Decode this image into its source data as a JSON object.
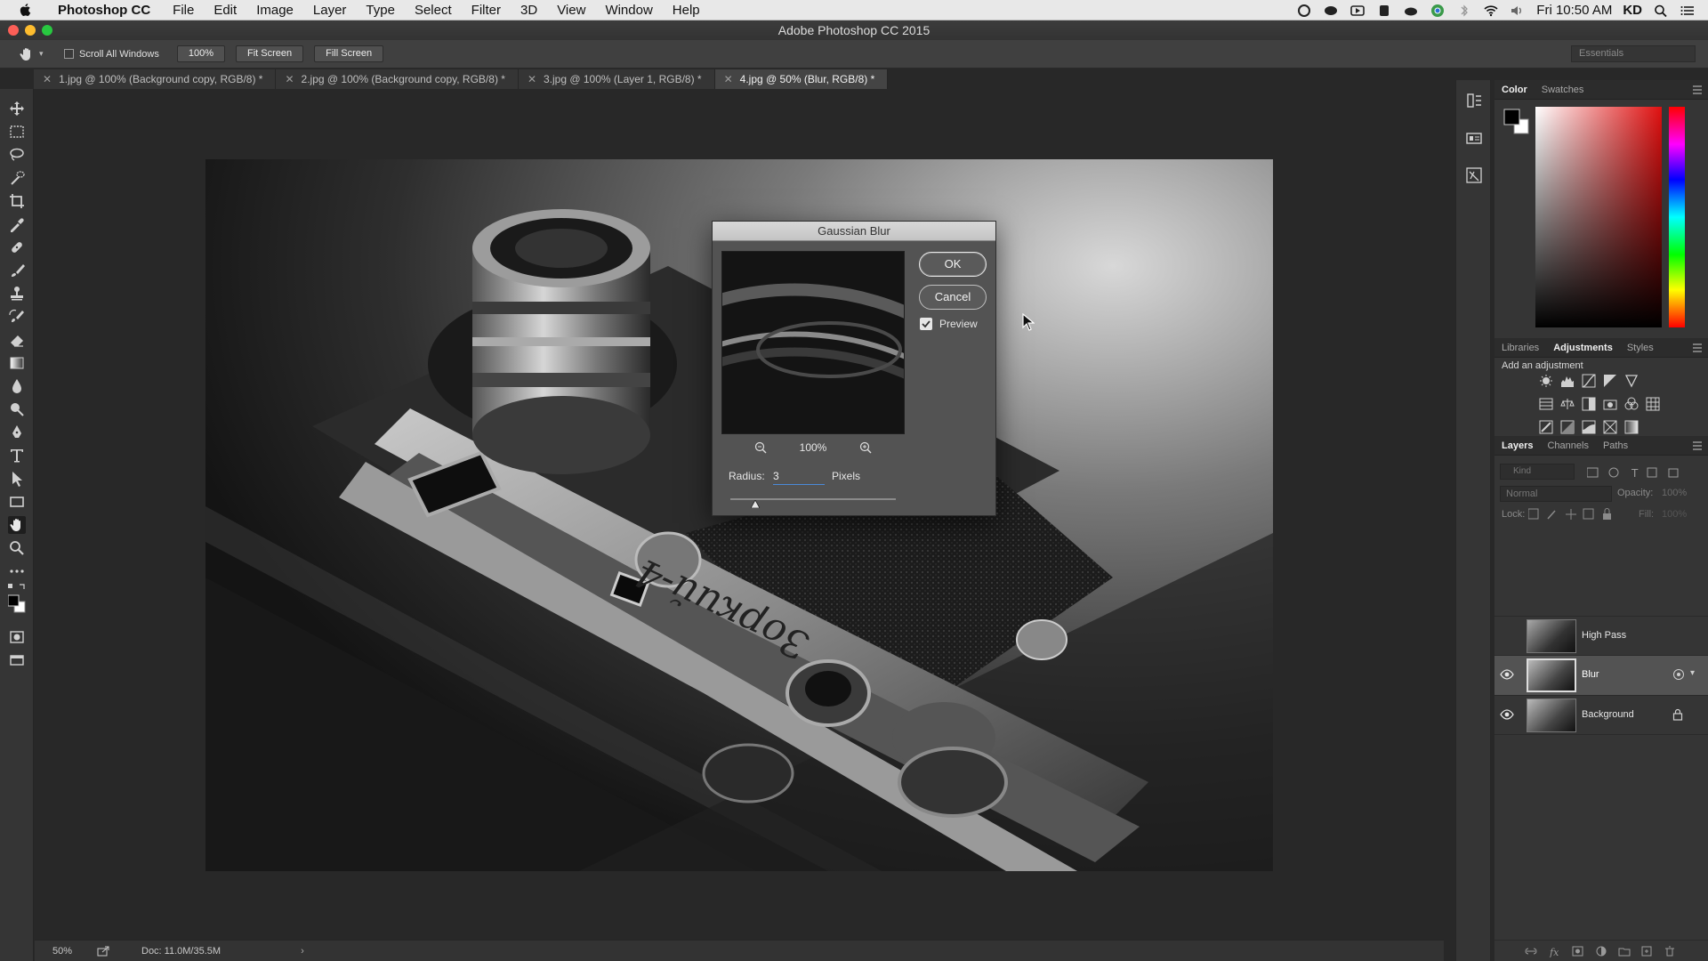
{
  "menubar": {
    "app_name": "Photoshop CC",
    "items": [
      "File",
      "Edit",
      "Image",
      "Layer",
      "Type",
      "Select",
      "Filter",
      "3D",
      "View",
      "Window",
      "Help"
    ],
    "clock": "Fri 10:50 AM",
    "user": "KD"
  },
  "window": {
    "title": "Adobe Photoshop CC 2015"
  },
  "options": {
    "scroll_all_windows": "Scroll All Windows",
    "zoom_button": "100%",
    "fit_screen": "Fit Screen",
    "fill_screen": "Fill Screen",
    "workspace": "Essentials"
  },
  "tabs": [
    {
      "label": "1.jpg @ 100% (Background copy, RGB/8) *",
      "active": false
    },
    {
      "label": "2.jpg @ 100% (Background copy, RGB/8) *",
      "active": false
    },
    {
      "label": "3.jpg @ 100% (Layer 1, RGB/8) *",
      "active": false
    },
    {
      "label": "4.jpg @ 50% (Blur, RGB/8) *",
      "active": true
    }
  ],
  "status": {
    "zoom": "50%",
    "doc": "Doc: 11.0M/35.5M"
  },
  "dialog": {
    "title": "Gaussian Blur",
    "ok": "OK",
    "cancel": "Cancel",
    "preview_label": "Preview",
    "preview_checked": true,
    "preview_zoom": "100%",
    "radius_label": "Radius:",
    "radius_value": "3",
    "radius_unit": "Pixels",
    "slider_fraction": 0.15
  },
  "color_panel": {
    "tabs": [
      "Color",
      "Swatches"
    ],
    "active": "Color"
  },
  "adjust_panel": {
    "tabs": [
      "Libraries",
      "Adjustments",
      "Styles"
    ],
    "active": "Adjustments",
    "heading": "Add an adjustment"
  },
  "layers_panel": {
    "tabs": [
      "Layers",
      "Channels",
      "Paths"
    ],
    "active": "Layers",
    "kind_placeholder": "Kind",
    "blend_mode": "Normal",
    "opacity_label": "Opacity:",
    "opacity_value": "100%",
    "lock_label": "Lock:",
    "fill_label": "Fill:",
    "fill_value": "100%",
    "layers": [
      {
        "name": "High Pass",
        "visible": false,
        "selected": false
      },
      {
        "name": "Blur",
        "visible": true,
        "selected": true
      },
      {
        "name": "Background",
        "visible": true,
        "selected": false,
        "locked": true
      }
    ]
  },
  "colors": {
    "accent": "#4a8ad8",
    "canvas_bg": "#282828",
    "panel_bg": "#353535"
  }
}
